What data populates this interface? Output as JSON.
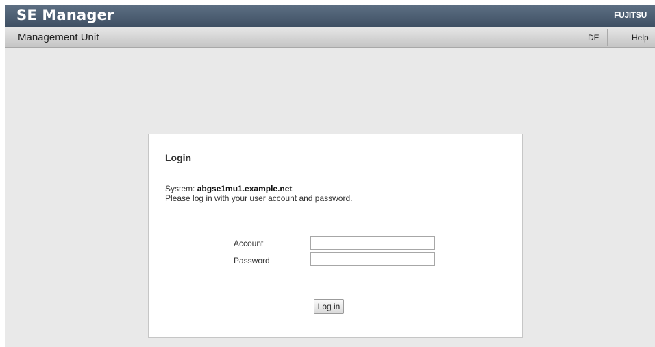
{
  "header": {
    "app_title": "SE Manager",
    "brand": "FUJITSU"
  },
  "subheader": {
    "section_title": "Management Unit",
    "language_link": "DE",
    "help_link": "Help"
  },
  "login": {
    "heading": "Login",
    "system_label": "System:",
    "system_value": "abgse1mu1.example.net",
    "instructions": "Please log in with your user account and password.",
    "account_label": "Account",
    "account_value": "",
    "password_label": "Password",
    "password_value": "",
    "submit_label": "Log in"
  }
}
